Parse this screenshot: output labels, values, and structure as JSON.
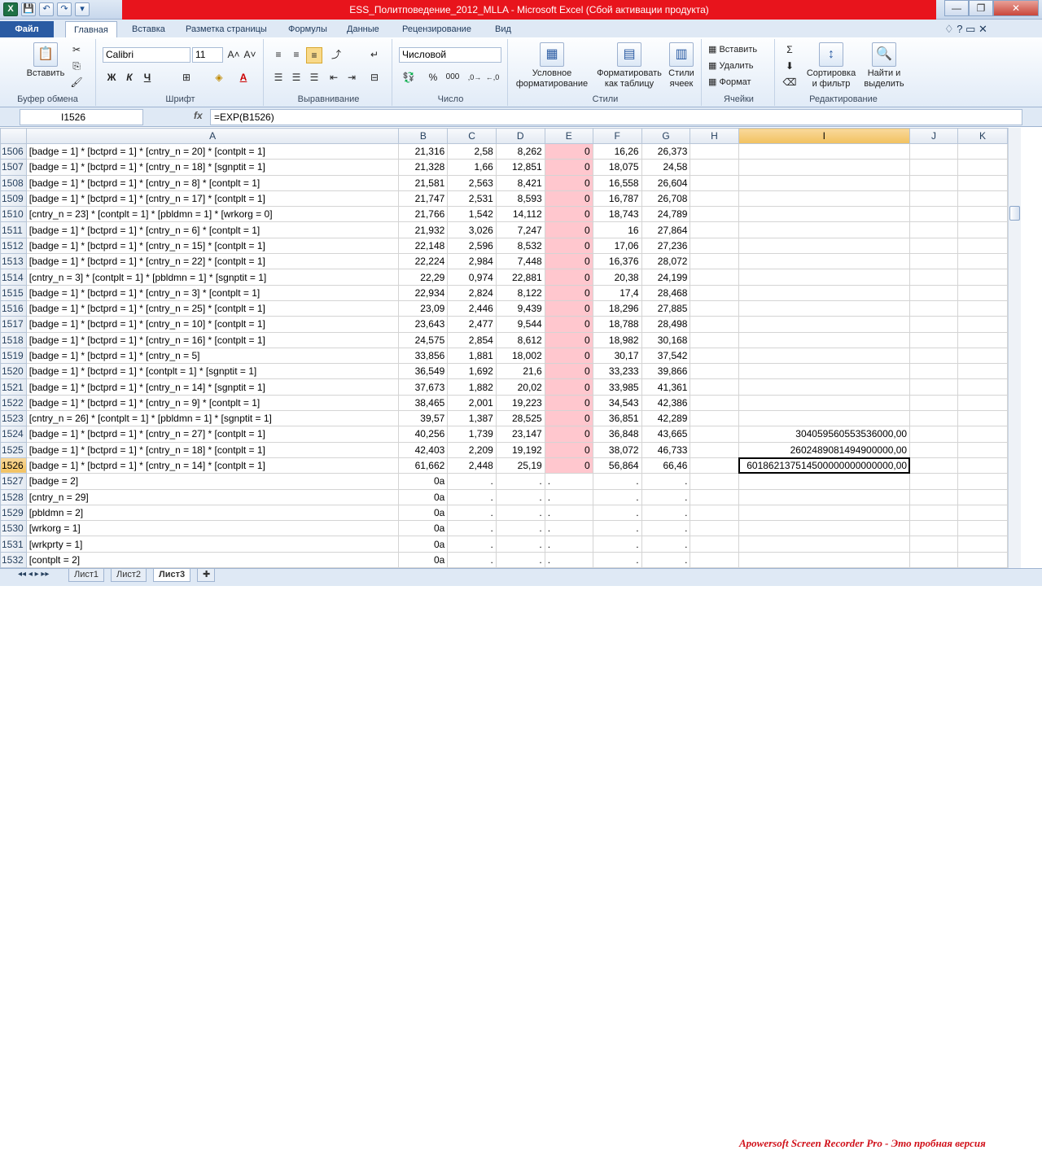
{
  "window": {
    "title": "ESS_Политповедение_2012_MLLA - Microsoft Excel (Сбой активации продукта)",
    "qat": [
      "X",
      "💾",
      "↶",
      "↷",
      "▾"
    ],
    "buttons": [
      "—",
      "❐",
      "✕"
    ]
  },
  "ribbon_tabs": [
    "Файл",
    "Главная",
    "Вставка",
    "Разметка страницы",
    "Формулы",
    "Данные",
    "Рецензирование",
    "Вид"
  ],
  "ribbon": {
    "clipboard": {
      "paste": "Вставить",
      "label": "Буфер обмена"
    },
    "font": {
      "name": "Calibri",
      "size": "11",
      "label": "Шрифт",
      "bold": "Ж",
      "italic": "К",
      "underline": "Ч"
    },
    "alignment": {
      "label": "Выравнивание"
    },
    "number": {
      "format": "Числовой",
      "label": "Число",
      "percent": "%",
      "thousands": "000"
    },
    "styles": {
      "cond1": "Условное",
      "cond2": "форматирование",
      "table1": "Форматировать",
      "table2": "как таблицу",
      "cell1": "Стили",
      "cell2": "ячеек",
      "label": "Стили"
    },
    "cells": {
      "insert": "Вставить",
      "delete": "Удалить",
      "format": "Формат",
      "label": "Ячейки"
    },
    "editing": {
      "sort1": "Сортировка",
      "sort2": "и фильтр",
      "find1": "Найти и",
      "find2": "выделить",
      "label": "Редактирование"
    }
  },
  "formula_bar": {
    "name_box": "I1526",
    "fx": "fx",
    "formula": "=EXP(B1526)"
  },
  "columns": [
    "A",
    "B",
    "C",
    "D",
    "E",
    "F",
    "G",
    "H",
    "I",
    "J",
    "K"
  ],
  "rows": [
    {
      "n": "1506",
      "a": "[badge = 1] * [bctprd = 1] * [cntry_n = 20] * [contplt = 1]",
      "b": "21,316",
      "c": "2,58",
      "d": "8,262",
      "e": "0",
      "f": "16,26",
      "g": "26,373",
      "i": ""
    },
    {
      "n": "1507",
      "a": "[badge = 1] * [bctprd = 1] * [cntry_n = 18] * [sgnptit = 1]",
      "b": "21,328",
      "c": "1,66",
      "d": "12,851",
      "e": "0",
      "f": "18,075",
      "g": "24,58",
      "i": ""
    },
    {
      "n": "1508",
      "a": "[badge = 1] * [bctprd = 1] * [cntry_n = 8] * [contplt = 1]",
      "b": "21,581",
      "c": "2,563",
      "d": "8,421",
      "e": "0",
      "f": "16,558",
      "g": "26,604",
      "i": ""
    },
    {
      "n": "1509",
      "a": "[badge = 1] * [bctprd = 1] * [cntry_n = 17] * [contplt = 1]",
      "b": "21,747",
      "c": "2,531",
      "d": "8,593",
      "e": "0",
      "f": "16,787",
      "g": "26,708",
      "i": ""
    },
    {
      "n": "1510",
      "a": "[cntry_n = 23] * [contplt = 1] * [pbldmn = 1] * [wrkorg = 0]",
      "b": "21,766",
      "c": "1,542",
      "d": "14,112",
      "e": "0",
      "f": "18,743",
      "g": "24,789",
      "i": ""
    },
    {
      "n": "1511",
      "a": "[badge = 1] * [bctprd = 1] * [cntry_n = 6] * [contplt = 1]",
      "b": "21,932",
      "c": "3,026",
      "d": "7,247",
      "e": "0",
      "f": "16",
      "g": "27,864",
      "i": ""
    },
    {
      "n": "1512",
      "a": "[badge = 1] * [bctprd = 1] * [cntry_n = 15] * [contplt = 1]",
      "b": "22,148",
      "c": "2,596",
      "d": "8,532",
      "e": "0",
      "f": "17,06",
      "g": "27,236",
      "i": ""
    },
    {
      "n": "1513",
      "a": "[badge = 1] * [bctprd = 1] * [cntry_n = 22] * [contplt = 1]",
      "b": "22,224",
      "c": "2,984",
      "d": "7,448",
      "e": "0",
      "f": "16,376",
      "g": "28,072",
      "i": ""
    },
    {
      "n": "1514",
      "a": "[cntry_n = 3] * [contplt = 1] * [pbldmn = 1] * [sgnptit = 1]",
      "b": "22,29",
      "c": "0,974",
      "d": "22,881",
      "e": "0",
      "f": "20,38",
      "g": "24,199",
      "i": ""
    },
    {
      "n": "1515",
      "a": "[badge = 1] * [bctprd = 1] * [cntry_n = 3] * [contplt = 1]",
      "b": "22,934",
      "c": "2,824",
      "d": "8,122",
      "e": "0",
      "f": "17,4",
      "g": "28,468",
      "i": ""
    },
    {
      "n": "1516",
      "a": "[badge = 1] * [bctprd = 1] * [cntry_n = 25] * [contplt = 1]",
      "b": "23,09",
      "c": "2,446",
      "d": "9,439",
      "e": "0",
      "f": "18,296",
      "g": "27,885",
      "i": ""
    },
    {
      "n": "1517",
      "a": "[badge = 1] * [bctprd = 1] * [cntry_n = 10] * [contplt = 1]",
      "b": "23,643",
      "c": "2,477",
      "d": "9,544",
      "e": "0",
      "f": "18,788",
      "g": "28,498",
      "i": ""
    },
    {
      "n": "1518",
      "a": "[badge = 1] * [bctprd = 1] * [cntry_n = 16] * [contplt = 1]",
      "b": "24,575",
      "c": "2,854",
      "d": "8,612",
      "e": "0",
      "f": "18,982",
      "g": "30,168",
      "i": ""
    },
    {
      "n": "1519",
      "a": "[badge = 1] * [bctprd = 1] * [cntry_n = 5]",
      "b": "33,856",
      "c": "1,881",
      "d": "18,002",
      "e": "0",
      "f": "30,17",
      "g": "37,542",
      "i": ""
    },
    {
      "n": "1520",
      "a": "[badge = 1] * [bctprd = 1] * [contplt = 1] * [sgnptit = 1]",
      "b": "36,549",
      "c": "1,692",
      "d": "21,6",
      "e": "0",
      "f": "33,233",
      "g": "39,866",
      "i": ""
    },
    {
      "n": "1521",
      "a": "[badge = 1] * [bctprd = 1] * [cntry_n = 14] * [sgnptit = 1]",
      "b": "37,673",
      "c": "1,882",
      "d": "20,02",
      "e": "0",
      "f": "33,985",
      "g": "41,361",
      "i": ""
    },
    {
      "n": "1522",
      "a": "[badge = 1] * [bctprd = 1] * [cntry_n = 9] * [contplt = 1]",
      "b": "38,465",
      "c": "2,001",
      "d": "19,223",
      "e": "0",
      "f": "34,543",
      "g": "42,386",
      "i": ""
    },
    {
      "n": "1523",
      "a": "[cntry_n = 26] * [contplt = 1] * [pbldmn = 1] * [sgnptit = 1]",
      "b": "39,57",
      "c": "1,387",
      "d": "28,525",
      "e": "0",
      "f": "36,851",
      "g": "42,289",
      "i": ""
    },
    {
      "n": "1524",
      "a": "[badge = 1] * [bctprd = 1] * [cntry_n = 27] * [contplt = 1]",
      "b": "40,256",
      "c": "1,739",
      "d": "23,147",
      "e": "0",
      "f": "36,848",
      "g": "43,665",
      "i": "304059560553536000,00"
    },
    {
      "n": "1525",
      "a": "[badge = 1] * [bctprd = 1] * [cntry_n = 18] * [contplt = 1]",
      "b": "42,403",
      "c": "2,209",
      "d": "19,192",
      "e": "0",
      "f": "38,072",
      "g": "46,733",
      "i": "2602489081494900000,00"
    },
    {
      "n": "1526",
      "a": "[badge = 1] * [bctprd = 1] * [cntry_n = 14] * [contplt = 1]",
      "b": "61,662",
      "c": "2,448",
      "d": "25,19",
      "e": "0",
      "f": "56,864",
      "g": "66,46",
      "i": "601862137514500000000000000,00"
    },
    {
      "n": "1527",
      "a": "[badge = 2]",
      "b": "0a",
      "c": ".",
      "d": ".",
      "e": ".",
      "f": ".",
      "g": ".",
      "i": ""
    },
    {
      "n": "1528",
      "a": "[cntry_n = 29]",
      "b": "0a",
      "c": ".",
      "d": ".",
      "e": ".",
      "f": ".",
      "g": ".",
      "i": ""
    },
    {
      "n": "1529",
      "a": "[pbldmn = 2]",
      "b": "0a",
      "c": ".",
      "d": ".",
      "e": ".",
      "f": ".",
      "g": ".",
      "i": ""
    },
    {
      "n": "1530",
      "a": "[wrkorg = 1]",
      "b": "0a",
      "c": ".",
      "d": ".",
      "e": ".",
      "f": ".",
      "g": ".",
      "i": ""
    },
    {
      "n": "1531",
      "a": "[wrkprty = 1]",
      "b": "0a",
      "c": ".",
      "d": ".",
      "e": ".",
      "f": ".",
      "g": ".",
      "i": ""
    },
    {
      "n": "1532",
      "a": "[contplt = 2]",
      "b": "0a",
      "c": ".",
      "d": ".",
      "e": ".",
      "f": ".",
      "g": ".",
      "i": ""
    }
  ],
  "active_row": "1526",
  "active_column": "I",
  "sheets": [
    "Лист1",
    "Лист2",
    "Лист3"
  ],
  "active_sheet": "Лист3",
  "watermark": "Apowersoft Screen Recorder Pro - Это пробная версия",
  "colors": {
    "highlight_pink": "#ffc7ce",
    "title_red": "#e8141c",
    "file_tab": "#2a5ba3"
  }
}
